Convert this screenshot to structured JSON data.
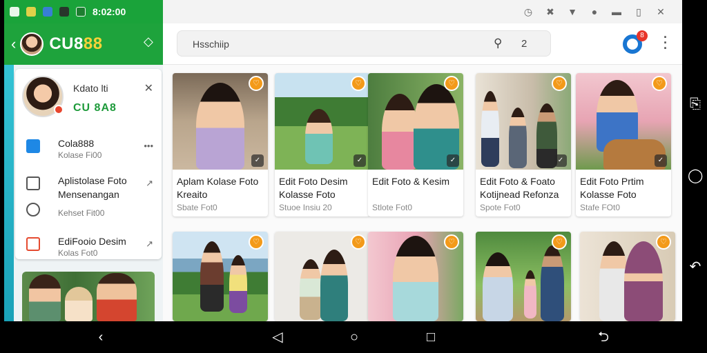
{
  "status": {
    "left_icons": [
      "settings-icon",
      "notes-icon",
      "image-icon",
      "camera-icon",
      "photo-icon"
    ],
    "clock": "8:02:00",
    "right_icons": [
      "alarm-icon",
      "mute-icon",
      "wifi-icon",
      "record-icon",
      "minimize-icon",
      "battery-icon",
      "close-icon"
    ]
  },
  "app": {
    "brand_prefix": "CU8",
    "brand_highlight": "88"
  },
  "drawer": {
    "profile_name": "Kdato lti",
    "profile_sub": "CU 8A8",
    "items": [
      {
        "title": "Cola888",
        "sub": "Kolase Fi00",
        "action": "•••"
      },
      {
        "title": "Aplistolase Foto Mensenangan",
        "sub": "Kehset Fit00",
        "action": "↗"
      },
      {
        "title": "EdiFooio Desim",
        "sub": "Kolas Fot0",
        "action": "↗"
      }
    ]
  },
  "search": {
    "text": "Hsschiip",
    "count": "2"
  },
  "notif_count": "8",
  "cards": [
    {
      "title": "Aplam Kolase Foto Kreaito",
      "sub": "Sbate Fot0"
    },
    {
      "title": "Edit Foto Desim Kolasse Foto",
      "sub": "Stuoe Insiu 20"
    },
    {
      "title": "Edit Foto & Kesim",
      "sub": "Stlote Fot0"
    },
    {
      "title": "Edit Foto & Foato Kotijnead Refonza",
      "sub": "Spote Fot0"
    },
    {
      "title": "Edit Foto Prtim Kolasse Foto",
      "sub": "Stafe FOt0"
    },
    {
      "title": "",
      "sub": ""
    },
    {
      "title": "",
      "sub": ""
    },
    {
      "title": "",
      "sub": ""
    },
    {
      "title": "",
      "sub": ""
    },
    {
      "title": "",
      "sub": ""
    }
  ]
}
